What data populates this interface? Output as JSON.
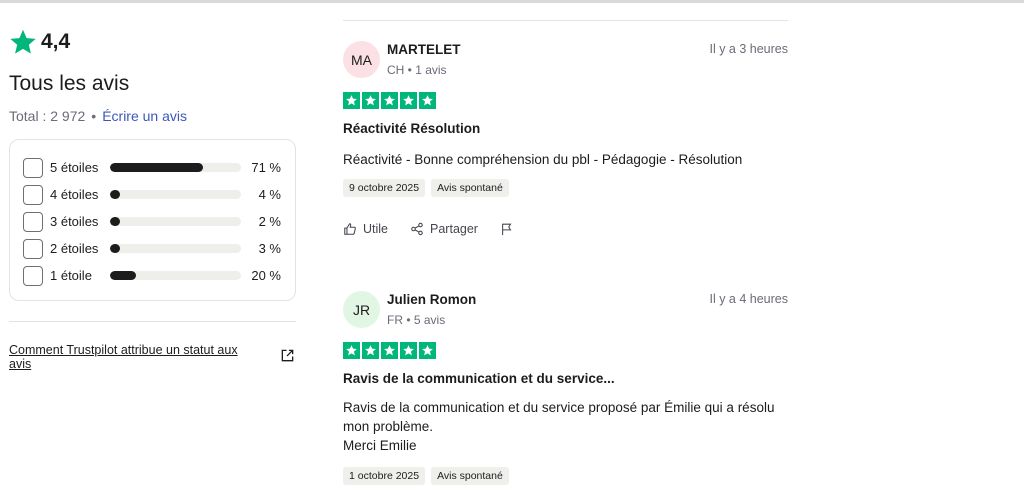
{
  "summary": {
    "rating": "4,4",
    "title": "Tous les avis",
    "total": "Total : 2 972",
    "separator": "•",
    "write_review": "Écrire un avis"
  },
  "distribution": [
    {
      "label": "5 étoiles",
      "pct": "71 %",
      "fill": 0.71
    },
    {
      "label": "4 étoiles",
      "pct": "4 %",
      "fill": 0.04
    },
    {
      "label": "3 étoiles",
      "pct": "2 %",
      "fill": 0.02
    },
    {
      "label": "2 étoiles",
      "pct": "3 %",
      "fill": 0.03
    },
    {
      "label": "1 étoile",
      "pct": "20 %",
      "fill": 0.2
    }
  ],
  "status_link": "Comment Trustpilot attribue un statut aux avis",
  "reviews": [
    {
      "initials": "MA",
      "avatar_color": "#fbe1e6",
      "name": "MARTELET",
      "meta": "CH • 1 avis",
      "time": "Il y a 3 heures",
      "stars": 5,
      "title": "Réactivité Résolution",
      "body": "Réactivité - Bonne compréhension du pbl - Pédagogie - Résolution",
      "date": "9 octobre 2025",
      "tag": "Avis spontané",
      "useful": "Utile",
      "share": "Partager"
    },
    {
      "initials": "JR",
      "avatar_color": "#e2f6e4",
      "name": "Julien Romon",
      "meta": "FR • 5 avis",
      "time": "Il y a 4 heures",
      "stars": 5,
      "title": "Ravis de la communication et du service...",
      "body_line1": "Ravis de la communication et du service proposé par Émilie qui a résolu",
      "body_line2": "mon problème.",
      "body_line3": "Merci Emilie",
      "date": "1 octobre 2025",
      "tag": "Avis spontané"
    }
  ],
  "colors": {
    "trustpilot_green": "#00b67a",
    "link_blue": "#3c57bc",
    "bar_fill": "#1c1c1c"
  }
}
